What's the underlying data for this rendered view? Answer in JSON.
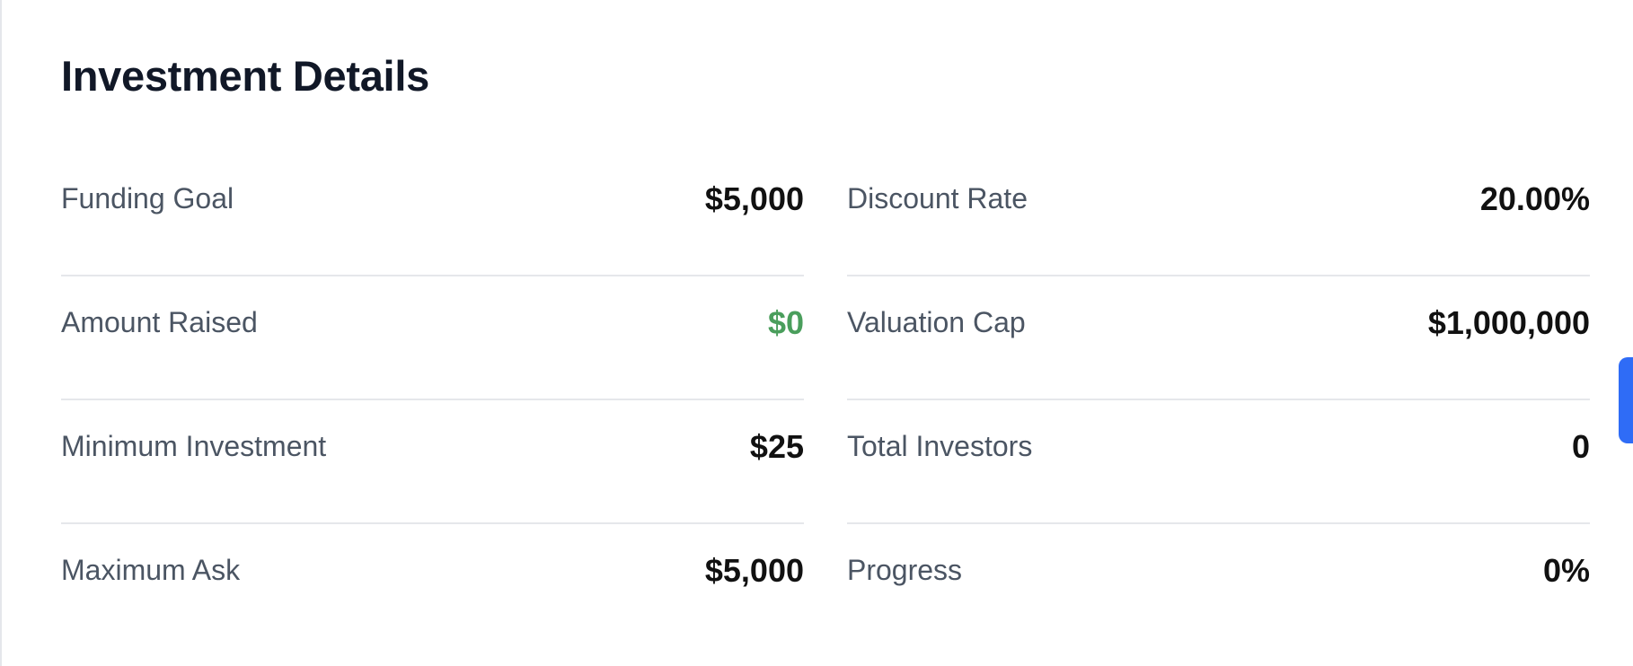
{
  "card": {
    "title": "Investment Details"
  },
  "left_column": [
    {
      "label": "Funding Goal",
      "value": "$5,000"
    },
    {
      "label": "Amount Raised",
      "value": "$0"
    },
    {
      "label": "Minimum Investment",
      "value": "$25"
    },
    {
      "label": "Maximum Ask",
      "value": "$5,000"
    }
  ],
  "right_column": [
    {
      "label": "Discount Rate",
      "value": "20.00%"
    },
    {
      "label": "Valuation Cap",
      "value": "$1,000,000"
    },
    {
      "label": "Total Investors",
      "value": "0"
    },
    {
      "label": "Progress",
      "value": "0%"
    }
  ],
  "colors": {
    "title": "#111827",
    "label": "#4b5563",
    "value": "#111111",
    "amount_raised": "#4a9e5c",
    "divider": "#e5e7eb",
    "side_tab": "#2f6cf6"
  }
}
